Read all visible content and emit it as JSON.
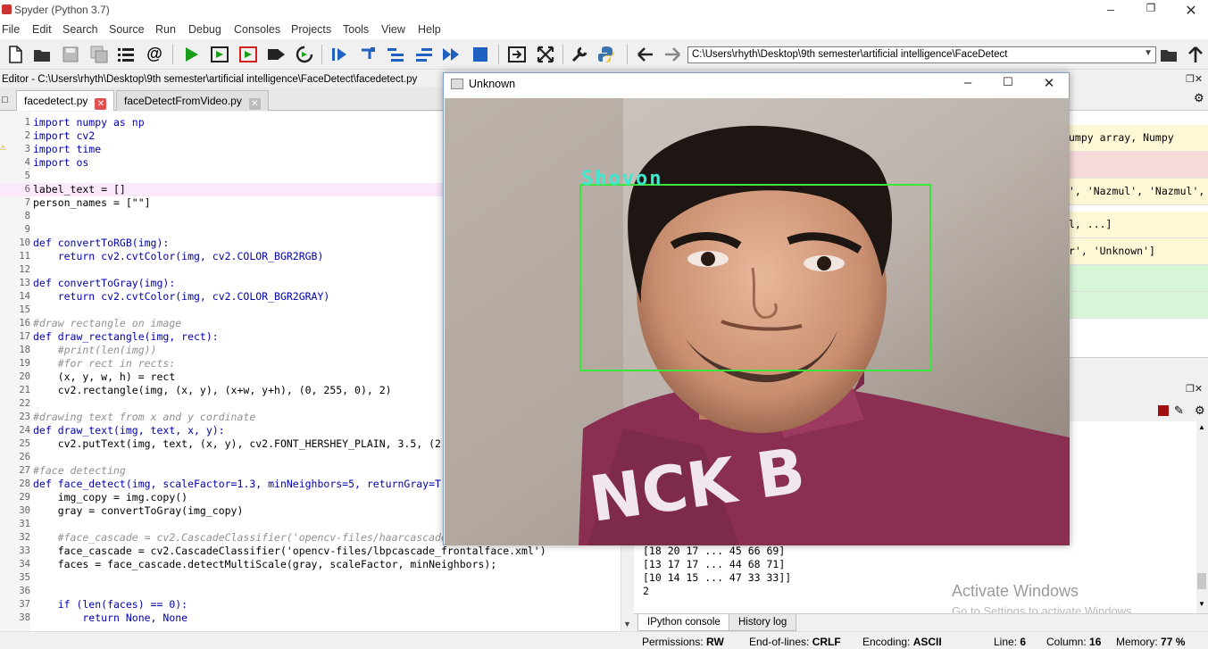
{
  "window": {
    "title": "Spyder (Python 3.7)"
  },
  "menu": [
    "File",
    "Edit",
    "Search",
    "Source",
    "Run",
    "Debug",
    "Consoles",
    "Projects",
    "Tools",
    "View",
    "Help"
  ],
  "toolbar": {
    "path": "C:\\Users\\rhyth\\Desktop\\9th semester\\artificial intelligence\\FaceDetect"
  },
  "editor": {
    "title": "Editor - C:\\Users\\rhyth\\Desktop\\9th semester\\artificial intelligence\\FaceDetect\\facedetect.py",
    "tabs": [
      "facedetect.py",
      "faceDetectFromVideo.py"
    ]
  },
  "code_lines": [
    {
      "n": "1",
      "t": "import numpy as np"
    },
    {
      "n": "2",
      "t": "import cv2"
    },
    {
      "n": "3",
      "t": "import time"
    },
    {
      "n": "4",
      "t": "import os"
    },
    {
      "n": "5",
      "t": ""
    },
    {
      "n": "6",
      "t": "label_text = []"
    },
    {
      "n": "7",
      "t": "person_names = [\"\"]"
    },
    {
      "n": "8",
      "t": ""
    },
    {
      "n": "9",
      "t": ""
    },
    {
      "n": "10",
      "t": "def convertToRGB(img):"
    },
    {
      "n": "11",
      "t": "    return cv2.cvtColor(img, cv2.COLOR_BGR2RGB)"
    },
    {
      "n": "12",
      "t": ""
    },
    {
      "n": "13",
      "t": "def convertToGray(img):"
    },
    {
      "n": "14",
      "t": "    return cv2.cvtColor(img, cv2.COLOR_BGR2GRAY)"
    },
    {
      "n": "15",
      "t": ""
    },
    {
      "n": "16",
      "t": "#draw rectangle on image"
    },
    {
      "n": "17",
      "t": "def draw_rectangle(img, rect):"
    },
    {
      "n": "18",
      "t": "    #print(len(img))"
    },
    {
      "n": "19",
      "t": "    #for rect in rects:"
    },
    {
      "n": "20",
      "t": "    (x, y, w, h) = rect"
    },
    {
      "n": "21",
      "t": "    cv2.rectangle(img, (x, y), (x+w, y+h), (0, 255, 0), 2)"
    },
    {
      "n": "22",
      "t": ""
    },
    {
      "n": "23",
      "t": "#drawing text from x and y cordinate"
    },
    {
      "n": "24",
      "t": "def draw_text(img, text, x, y):"
    },
    {
      "n": "25",
      "t": "    cv2.putText(img, text, (x, y), cv2.FONT_HERSHEY_PLAIN, 3.5, (2"
    },
    {
      "n": "26",
      "t": ""
    },
    {
      "n": "27",
      "t": "#face detecting"
    },
    {
      "n": "28",
      "t": "def face_detect(img, scaleFactor=1.3, minNeighbors=5, returnGray=T"
    },
    {
      "n": "29",
      "t": "    img_copy = img.copy()"
    },
    {
      "n": "30",
      "t": "    gray = convertToGray(img_copy)"
    },
    {
      "n": "31",
      "t": ""
    },
    {
      "n": "32",
      "t": "    #face_cascade = cv2.CascadeClassifier('opencv-files/haarcascade"
    },
    {
      "n": "33",
      "t": "    face_cascade = cv2.CascadeClassifier('opencv-files/lbpcascade_frontalface.xml')"
    },
    {
      "n": "34",
      "t": "    faces = face_cascade.detectMultiScale(gray, scaleFactor, minNeighbors);"
    },
    {
      "n": "35",
      "t": ""
    },
    {
      "n": "36",
      "t": ""
    },
    {
      "n": "37",
      "t": "    if (len(faces) == 0):"
    },
    {
      "n": "38",
      "t": "        return None, None"
    }
  ],
  "variables": [
    "umpy array, Numpy",
    "",
    "', 'Nazmul', 'Nazmul',",
    "l, ...]",
    "r', 'Unknown']",
    "",
    ""
  ],
  "console": {
    "lines": [
      "[18 20 17 ... 45 66 69]",
      "[13 17 17 ... 44 68 71]",
      "[10 14 15 ... 47 33 33]]",
      "2"
    ],
    "tabs": [
      "IPython console",
      "History log"
    ]
  },
  "popup": {
    "title": "Unknown",
    "label": "Shovon"
  },
  "status": {
    "permissions_label": "Permissions:",
    "permissions": "RW",
    "eol_label": "End-of-lines:",
    "eol": "CRLF",
    "encoding_label": "Encoding:",
    "encoding": "ASCII",
    "line_label": "Line:",
    "line": "6",
    "column_label": "Column:",
    "column": "16",
    "memory_label": "Memory:",
    "memory": "77 %"
  },
  "watermark": {
    "title": "Activate Windows",
    "subtitle": "Go to Settings to activate Windows."
  },
  "colors": {
    "run_green": "#1a9e1a",
    "tab_close": "#e05050",
    "box_green": "#39e639",
    "label_cyan": "#3fe8d0"
  }
}
